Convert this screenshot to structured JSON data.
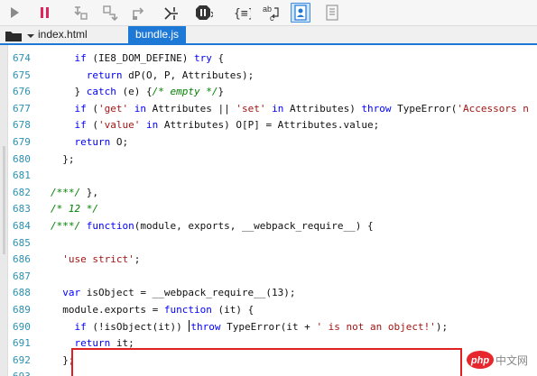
{
  "toolbar": {
    "buttons": [
      {
        "name": "continue-icon"
      },
      {
        "name": "pause-icon"
      },
      {
        "name": "step-into-icon"
      },
      {
        "name": "step-over-icon"
      },
      {
        "name": "step-out-icon"
      },
      {
        "name": "break-on-new-worker-icon"
      },
      {
        "name": "exception-behavior-icon"
      },
      {
        "name": "pretty-print-icon"
      },
      {
        "name": "word-wrap-icon"
      },
      {
        "name": "just-my-code-icon",
        "active": true
      },
      {
        "name": "clear-breakpoints-icon"
      }
    ]
  },
  "tabs": [
    {
      "label": "index.html",
      "active": false
    },
    {
      "label": "bundle.js",
      "active": true
    }
  ],
  "editor": {
    "lines": [
      {
        "n": "674",
        "tokens": [
          [
            "",
            "    "
          ],
          [
            "kw",
            "if"
          ],
          [
            "",
            " (IE8_DOM_DEFINE) "
          ],
          [
            "kw",
            "try"
          ],
          [
            "",
            " {"
          ]
        ]
      },
      {
        "n": "675",
        "tokens": [
          [
            "",
            "      "
          ],
          [
            "kw",
            "return"
          ],
          [
            "",
            " dP(O, P, Attributes);"
          ]
        ]
      },
      {
        "n": "676",
        "tokens": [
          [
            "",
            "    } "
          ],
          [
            "kw",
            "catch"
          ],
          [
            "",
            " (e) {"
          ],
          [
            "cm",
            "/* empty */"
          ],
          [
            "",
            "}"
          ]
        ]
      },
      {
        "n": "677",
        "tokens": [
          [
            "",
            "    "
          ],
          [
            "kw",
            "if"
          ],
          [
            "",
            " ("
          ],
          [
            "str",
            "'get'"
          ],
          [
            "",
            " "
          ],
          [
            "kw",
            "in"
          ],
          [
            "",
            " Attributes || "
          ],
          [
            "str",
            "'set'"
          ],
          [
            "",
            " "
          ],
          [
            "kw",
            "in"
          ],
          [
            "",
            " Attributes) "
          ],
          [
            "kw",
            "throw"
          ],
          [
            "",
            " TypeError("
          ],
          [
            "str",
            "'Accessors n"
          ]
        ]
      },
      {
        "n": "678",
        "tokens": [
          [
            "",
            "    "
          ],
          [
            "kw",
            "if"
          ],
          [
            "",
            " ("
          ],
          [
            "str",
            "'value'"
          ],
          [
            "",
            " "
          ],
          [
            "kw",
            "in"
          ],
          [
            "",
            " Attributes) O[P] = Attributes.value;"
          ]
        ]
      },
      {
        "n": "679",
        "tokens": [
          [
            "",
            "    "
          ],
          [
            "kw",
            "return"
          ],
          [
            "",
            " O;"
          ]
        ]
      },
      {
        "n": "680",
        "tokens": [
          [
            "",
            "  };"
          ]
        ]
      },
      {
        "n": "681",
        "tokens": []
      },
      {
        "n": "682",
        "tokens": [
          [
            "cm",
            "/***/"
          ],
          [
            "",
            " },"
          ]
        ]
      },
      {
        "n": "683",
        "tokens": [
          [
            "cm",
            "/* 12 */"
          ]
        ]
      },
      {
        "n": "684",
        "tokens": [
          [
            "cm",
            "/***/"
          ],
          [
            "",
            " "
          ],
          [
            "kw",
            "function"
          ],
          [
            "",
            "(module, exports, __webpack_require__) {"
          ]
        ]
      },
      {
        "n": "685",
        "tokens": []
      },
      {
        "n": "686",
        "tokens": [
          [
            "",
            "  "
          ],
          [
            "str",
            "'use strict'"
          ],
          [
            "",
            ";"
          ]
        ]
      },
      {
        "n": "687",
        "tokens": []
      },
      {
        "n": "688",
        "tokens": [
          [
            "",
            "  "
          ],
          [
            "kw",
            "var"
          ],
          [
            "",
            " isObject = __webpack_require__(13);"
          ]
        ]
      },
      {
        "n": "689",
        "tokens": [
          [
            "",
            "  module.exports = "
          ],
          [
            "kw",
            "function"
          ],
          [
            "",
            " (it) {"
          ]
        ]
      },
      {
        "n": "690",
        "tokens": [
          [
            "",
            "    "
          ],
          [
            "kw",
            "if"
          ],
          [
            "",
            " (!isObject(it)) "
          ],
          [
            "cursor",
            ""
          ],
          [
            "kw",
            "throw"
          ],
          [
            "",
            " TypeError(it + "
          ],
          [
            "str",
            "' is not an object!'"
          ],
          [
            "",
            ");"
          ]
        ]
      },
      {
        "n": "691",
        "tokens": [
          [
            "",
            "    "
          ],
          [
            "kw",
            "return"
          ],
          [
            "",
            " it;"
          ]
        ]
      },
      {
        "n": "692",
        "tokens": [
          [
            "",
            "  };"
          ]
        ]
      },
      {
        "n": "693",
        "tokens": []
      }
    ]
  },
  "colors": {
    "accent": "#1e78d6",
    "keyword": "#0000ff",
    "string": "#a31515",
    "comment": "#008000",
    "line_number": "#2b91af",
    "highlight": "#e02020"
  },
  "watermark": {
    "text": "php",
    "suffix": "中文网"
  }
}
